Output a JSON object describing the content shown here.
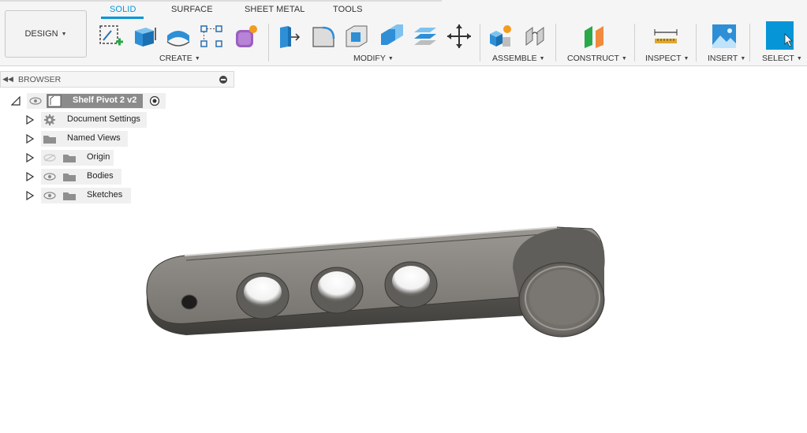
{
  "design_menu": {
    "label": "DESIGN"
  },
  "tabs": [
    {
      "label": "SOLID",
      "active": true
    },
    {
      "label": "SURFACE",
      "active": false
    },
    {
      "label": "SHEET METAL",
      "active": false
    },
    {
      "label": "TOOLS",
      "active": false
    }
  ],
  "groups": {
    "create": "CREATE",
    "modify": "MODIFY",
    "assemble": "ASSEMBLE",
    "construct": "CONSTRUCT",
    "inspect": "INSPECT",
    "insert": "INSERT",
    "select": "SELECT"
  },
  "browser": {
    "title": "BROWSER",
    "root": {
      "label": "Shelf Pivot 2 v2"
    },
    "items": [
      {
        "label": "Document Settings",
        "icon": "gear-icon",
        "visible": null
      },
      {
        "label": "Named Views",
        "icon": "folder-icon",
        "visible": null
      },
      {
        "label": "Origin",
        "icon": "folder-icon",
        "visible": false
      },
      {
        "label": "Bodies",
        "icon": "folder-icon",
        "visible": true
      },
      {
        "label": "Sketches",
        "icon": "folder-icon",
        "visible": true
      }
    ]
  },
  "colors": {
    "accent": "#0696d7",
    "toolbar_bg": "#f5f5f5",
    "part_gray": "#6f6c68"
  }
}
